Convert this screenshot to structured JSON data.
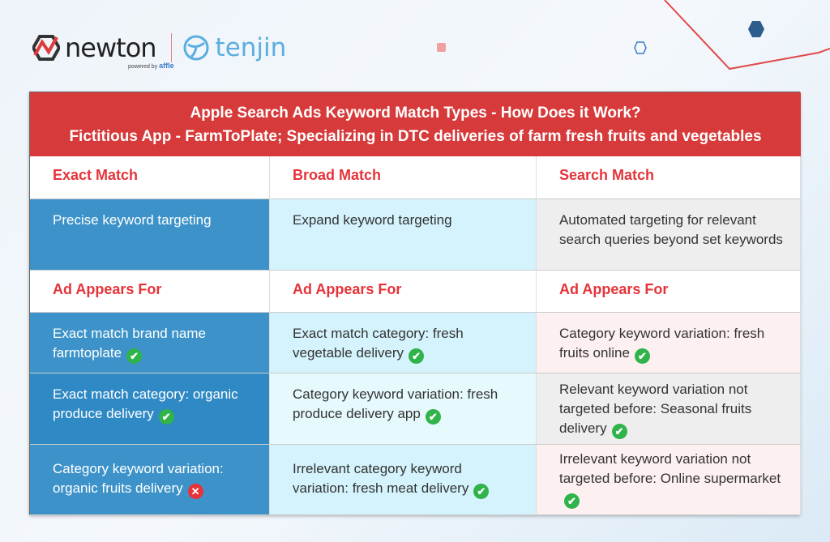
{
  "logos": {
    "newton": "newton",
    "powered_by": "powered by",
    "affle": "affle",
    "tenjin": "tenjin"
  },
  "header": {
    "title": "Apple Search Ads Keyword Match Types - How Does it Work?",
    "subtitle": "Fictitious App - FarmToPlate; Specializing in DTC deliveries of farm fresh fruits and vegetables"
  },
  "columns": [
    "Exact Match",
    "Broad Match",
    "Search Match"
  ],
  "descriptions": [
    "Precise keyword targeting",
    "Expand keyword targeting",
    "Automated targeting for relevant search queries beyond set keywords"
  ],
  "section_label": "Ad Appears For",
  "rows": [
    [
      {
        "text": "Exact match brand name farmtoplate",
        "status": "check"
      },
      {
        "text": "Exact match category: fresh vegetable delivery",
        "status": "check"
      },
      {
        "text": "Category keyword variation: fresh fruits online",
        "status": "check"
      }
    ],
    [
      {
        "text": "Exact match category: organic produce delivery",
        "status": "check"
      },
      {
        "text": "Category keyword variation: fresh produce delivery app",
        "status": "check"
      },
      {
        "text": "Relevant keyword variation not targeted before: Seasonal fruits delivery",
        "status": "check"
      }
    ],
    [
      {
        "text": "Category keyword variation: organic fruits delivery",
        "status": "cross"
      },
      {
        "text": "Irrelevant category keyword variation: fresh meat delivery",
        "status": "check"
      },
      {
        "text": "Irrelevant keyword variation not targeted before: Online supermarket",
        "status": "check"
      }
    ]
  ],
  "colors": {
    "header": "#d73a3a",
    "label": "#e4343a",
    "exact": "#3d93c9",
    "broad": "#d4f3fc",
    "search_gray": "#eeeeee",
    "search_pink": "#fdf0f0",
    "check": "#2fb34a",
    "cross": "#e8323a"
  }
}
